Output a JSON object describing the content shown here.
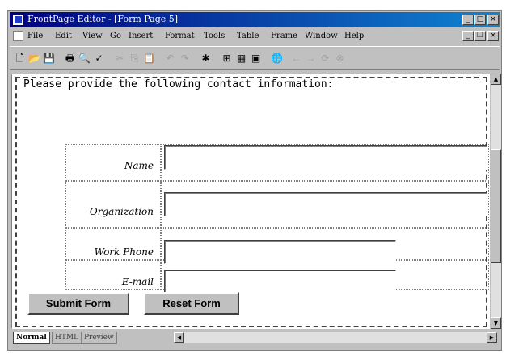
{
  "window": {
    "title": "FrontPage Editor - [Form Page 5]",
    "controls": {
      "minimize": "_",
      "maximize": "□",
      "close": "×"
    }
  },
  "menubar": {
    "items": [
      "File",
      "Edit",
      "View",
      "Go",
      "Insert",
      "Format",
      "Tools",
      "Table",
      "Frame",
      "Window",
      "Help"
    ],
    "doc_controls": {
      "minimize": "_",
      "restore": "❐",
      "close": "×"
    }
  },
  "toolbar": {
    "icons": [
      "new-icon",
      "open-icon",
      "save-icon",
      "print-icon",
      "print-preview-icon",
      "spell-check-icon",
      "cut-icon",
      "copy-icon",
      "paste-icon",
      "undo-icon",
      "redo-icon",
      "webbot-icon",
      "insert-table-icon",
      "insert-image-icon",
      "insert-hyperlink-icon",
      "back-icon",
      "forward-icon",
      "refresh-icon",
      "stop-icon"
    ],
    "glyphs": [
      "🗋",
      "📂",
      "💾",
      "🖶",
      "🔍",
      "✓",
      "✂",
      "⎘",
      "📋",
      "↶",
      "↷",
      "✱",
      "⊞",
      "▦",
      "▣",
      "🌐",
      "←",
      "→",
      "⟳",
      "⊗"
    ]
  },
  "form": {
    "intro": "Please provide the following contact information:",
    "fields": [
      {
        "label": "Name",
        "value": ""
      },
      {
        "label": "Organization",
        "value": ""
      },
      {
        "label": "Work Phone",
        "value": ""
      },
      {
        "label": "E-mail",
        "value": ""
      }
    ],
    "submit_label": "Submit Form",
    "reset_label": "Reset Form"
  },
  "view_tabs": [
    {
      "label": "Normal",
      "active": true
    },
    {
      "label": "HTML",
      "active": false
    },
    {
      "label": "Preview",
      "active": false
    }
  ],
  "scroll": {
    "up": "▲",
    "down": "▼",
    "left": "◀",
    "right": "▶"
  },
  "colors": {
    "titlebar_start": "#000080",
    "titlebar_end": "#1084d0",
    "chrome": "#c0c0c0"
  }
}
